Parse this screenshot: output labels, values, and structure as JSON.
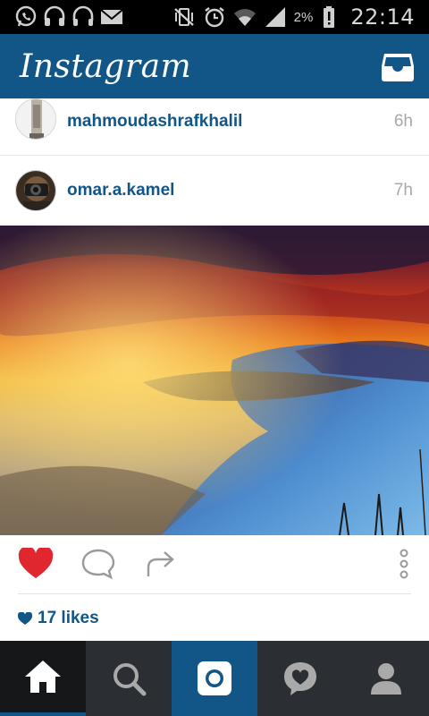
{
  "status_bar": {
    "battery_percent": "2%",
    "time": "22:14",
    "icons": [
      "whatsapp-icon",
      "headset-icon",
      "headphones-icon",
      "email-icon",
      "vibrate-off-icon",
      "alarm-icon",
      "wifi-icon",
      "signal-icon",
      "battery-low-icon"
    ]
  },
  "app_bar": {
    "title": "Instagram",
    "inbox_icon": "inbox-icon"
  },
  "feed": {
    "posts": [
      {
        "username": "mahmoudashrafkhalil",
        "time_ago": "6h"
      },
      {
        "username": "omar.a.kamel",
        "time_ago": "7h",
        "likes": "17 likes",
        "liked": true
      }
    ]
  },
  "actions": {
    "icons": [
      "heart-icon",
      "comment-icon",
      "share-icon",
      "more-options-icon"
    ]
  },
  "bottom_nav": {
    "items": [
      "home-icon",
      "search-icon",
      "camera-icon",
      "activity-icon",
      "profile-icon"
    ],
    "active": "home"
  },
  "colors": {
    "brand_blue": "#125688",
    "like_red": "#e0262f",
    "nav_dark": "#2b2f33"
  }
}
